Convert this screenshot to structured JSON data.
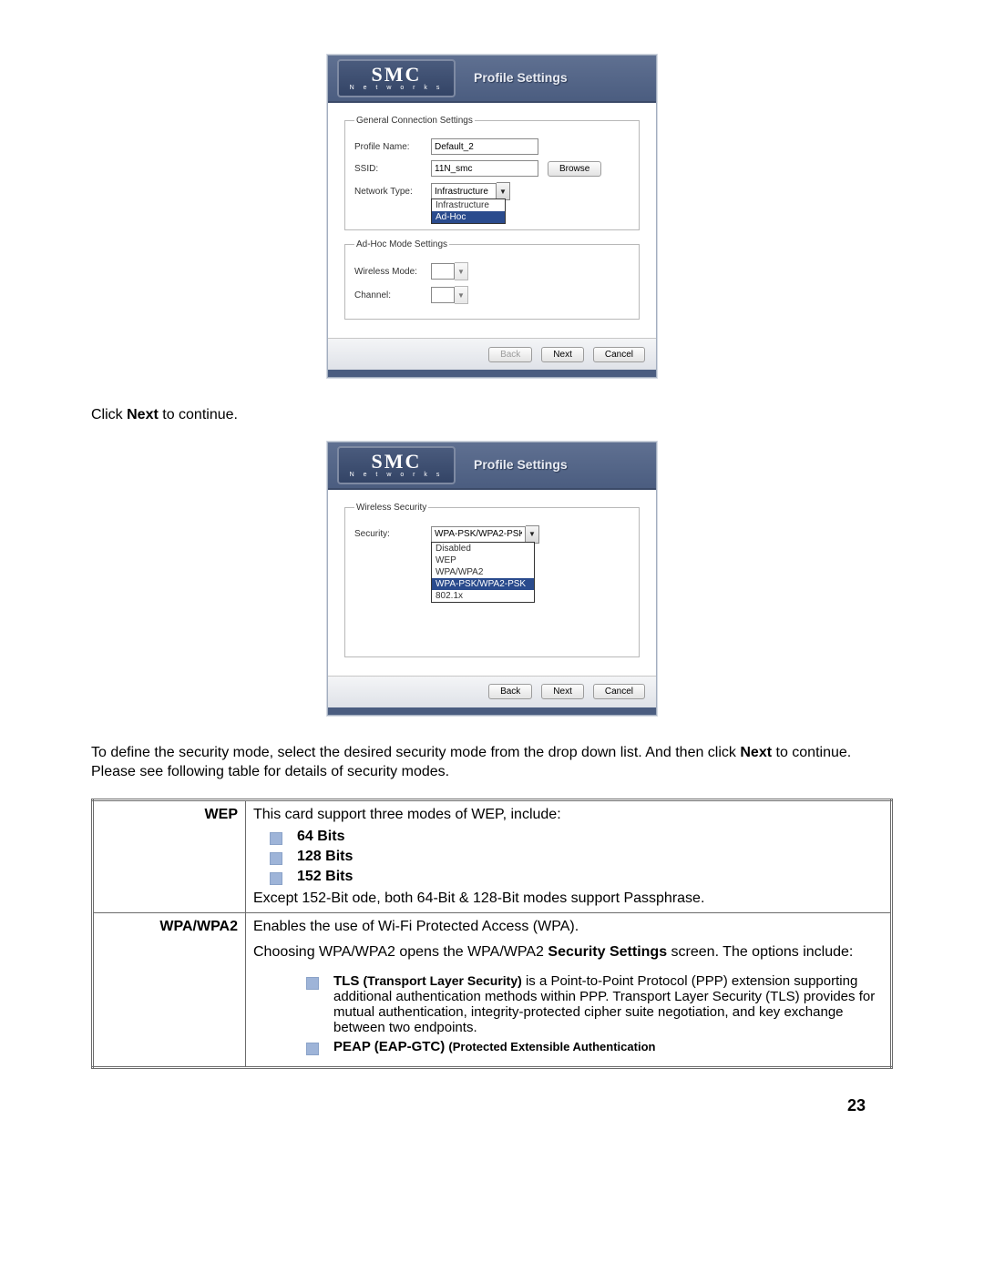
{
  "page_number": "23",
  "dialog_title": "Profile Settings",
  "logo": {
    "main": "SMC",
    "sub": "N e t w o r k s"
  },
  "dialog1": {
    "group1_legend": "General Connection Settings",
    "profile_name_label": "Profile Name:",
    "profile_name_value": "Default_2",
    "ssid_label": "SSID:",
    "ssid_value": "11N_smc",
    "browse_label": "Browse",
    "network_type_label": "Network Type:",
    "network_type_value": "Infrastructure",
    "network_type_options": [
      "Infrastructure",
      "Ad-Hoc"
    ],
    "group2_legend": "Ad-Hoc Mode Settings",
    "wireless_mode_label": "Wireless Mode:",
    "channel_label": "Channel:"
  },
  "dialog2": {
    "group_legend": "Wireless Security",
    "security_label": "Security:",
    "security_value": "WPA-PSK/WPA2-PSK",
    "security_options": [
      "Disabled",
      "WEP",
      "WPA/WPA2",
      "WPA-PSK/WPA2-PSK",
      "802.1x"
    ]
  },
  "buttons": {
    "back": "Back",
    "next": "Next",
    "cancel": "Cancel"
  },
  "text": {
    "click_next_prefix": "Click ",
    "click_next_bold": "Next",
    "click_next_suffix": " to continue.",
    "para2_a": "To define the security mode, select the desired security mode from the drop down list. And then click ",
    "para2_b": "Next",
    "para2_c": " to continue. Please see following table for details of security modes."
  },
  "table": {
    "row1_key": "WEP",
    "row1_intro": "This card support three modes of WEP, include:",
    "row1_bullets": [
      "64 Bits",
      "128 Bits",
      "152 Bits"
    ],
    "row1_tail": "Except 152-Bit ode, both 64-Bit & 128-Bit modes support Passphrase.",
    "row2_key": "WPA/WPA2",
    "row2_line1": "Enables the use of Wi-Fi Protected Access (WPA).",
    "row2_line2a": "Choosing WPA/WPA2 opens the WPA/WPA2 ",
    "row2_line2b": "Security Settings",
    "row2_line2c": " screen. The options include:",
    "row2_tls_a": "TLS ",
    "row2_tls_b": "(Transport Layer Security)",
    "row2_tls_c": " is a Point-to-Point Protocol (PPP) extension supporting additional authentication methods within PPP. Transport Layer Security (TLS) provides for mutual authentication, integrity-protected cipher suite negotiation, and key exchange between two endpoints.",
    "row2_peap_a": "PEAP (EAP-GTC)  ",
    "row2_peap_b": "(Protected Extensible Authentication"
  }
}
